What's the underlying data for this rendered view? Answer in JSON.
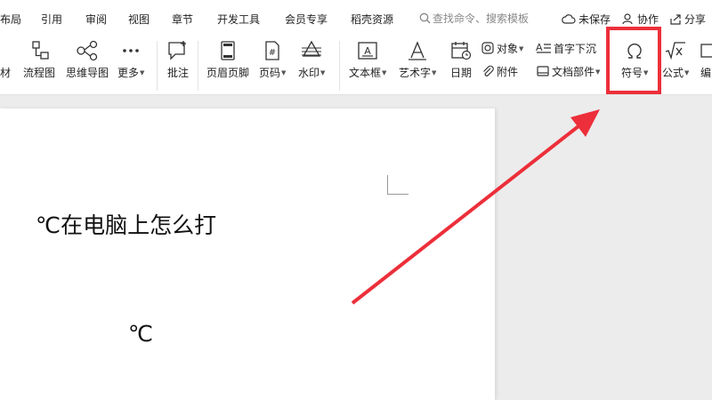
{
  "menu": {
    "items": [
      "布局",
      "引用",
      "审阅",
      "视图",
      "章节",
      "开发工具",
      "会员专享",
      "稻壳资源"
    ],
    "search_placeholder": "查找命令、搜索模板",
    "unsaved": "未保存",
    "collaborate": "协作",
    "share": "分享"
  },
  "toolbar": {
    "material": "材",
    "flowchart": "流程图",
    "mindmap": "思维导图",
    "more": "更多",
    "comment": "批注",
    "header_footer": "页眉页脚",
    "page_number": "页码",
    "watermark": "水印",
    "textbox": "文本框",
    "wordart": "艺术字",
    "date": "日期",
    "object": "对象",
    "attachment": "附件",
    "dropcap": "首字下沉",
    "doc_parts": "文档部件",
    "symbol": "符号",
    "formula": "公式",
    "edit": "编"
  },
  "document": {
    "heading": "℃在电脑上怎么打",
    "symbol": "℃"
  },
  "colors": {
    "highlight": "#ec2f3a",
    "background": "#ececec"
  }
}
